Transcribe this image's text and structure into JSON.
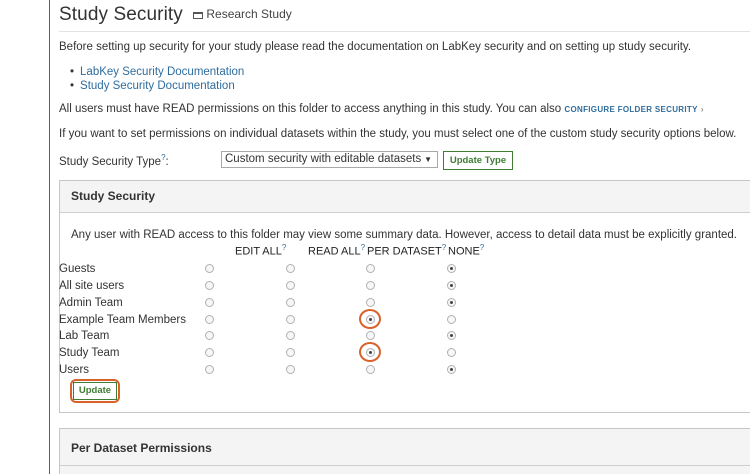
{
  "header": {
    "title": "Study Security",
    "folder_label": "Research Study"
  },
  "intro_text": "Before setting up security for your study please read the documentation on LabKey security and on setting up study security.",
  "doc_links": [
    "LabKey Security Documentation",
    "Study Security Documentation"
  ],
  "read_permissions": {
    "text": "All users must have READ permissions on this folder to access anything in this study. You can also",
    "link_label": "CONFIGURE FOLDER SECURITY",
    "link_arrow": "›"
  },
  "dataset_note": "If you want to set permissions on individual datasets within the study, you must select one of the custom study security options below.",
  "security_type": {
    "label": "Study Security Type",
    "help_mark": "?",
    "selected": "Custom security with editable datasets",
    "update_button": "Update Type"
  },
  "study_security_panel": {
    "title": "Study Security",
    "description": "Any user with READ access to this folder may view some summary data. However, access to detail data must be explicitly granted.",
    "columns": [
      {
        "label": "EDIT ALL",
        "help": "?"
      },
      {
        "label": "READ ALL",
        "help": "?"
      },
      {
        "label": "PER DATASET",
        "help": "?"
      },
      {
        "label": "NONE",
        "help": "?"
      }
    ],
    "rows": [
      {
        "group": "Guests",
        "selected": "NONE",
        "highlighted": false
      },
      {
        "group": "All site users",
        "selected": "NONE",
        "highlighted": false
      },
      {
        "group": "Admin Team",
        "selected": "NONE",
        "highlighted": false
      },
      {
        "group": "Example Team Members",
        "selected": "PER DATASET",
        "highlighted": true
      },
      {
        "group": "Lab Team",
        "selected": "NONE",
        "highlighted": false
      },
      {
        "group": "Study Team",
        "selected": "PER DATASET",
        "highlighted": true
      },
      {
        "group": "Users",
        "selected": "NONE",
        "highlighted": false
      }
    ],
    "update_button": "Update"
  },
  "per_dataset_panel": {
    "title": "Per Dataset Permissions"
  },
  "colors": {
    "link": "#2f6d9e",
    "button_green": "#3f7c34",
    "highlight": "#d9622b"
  }
}
